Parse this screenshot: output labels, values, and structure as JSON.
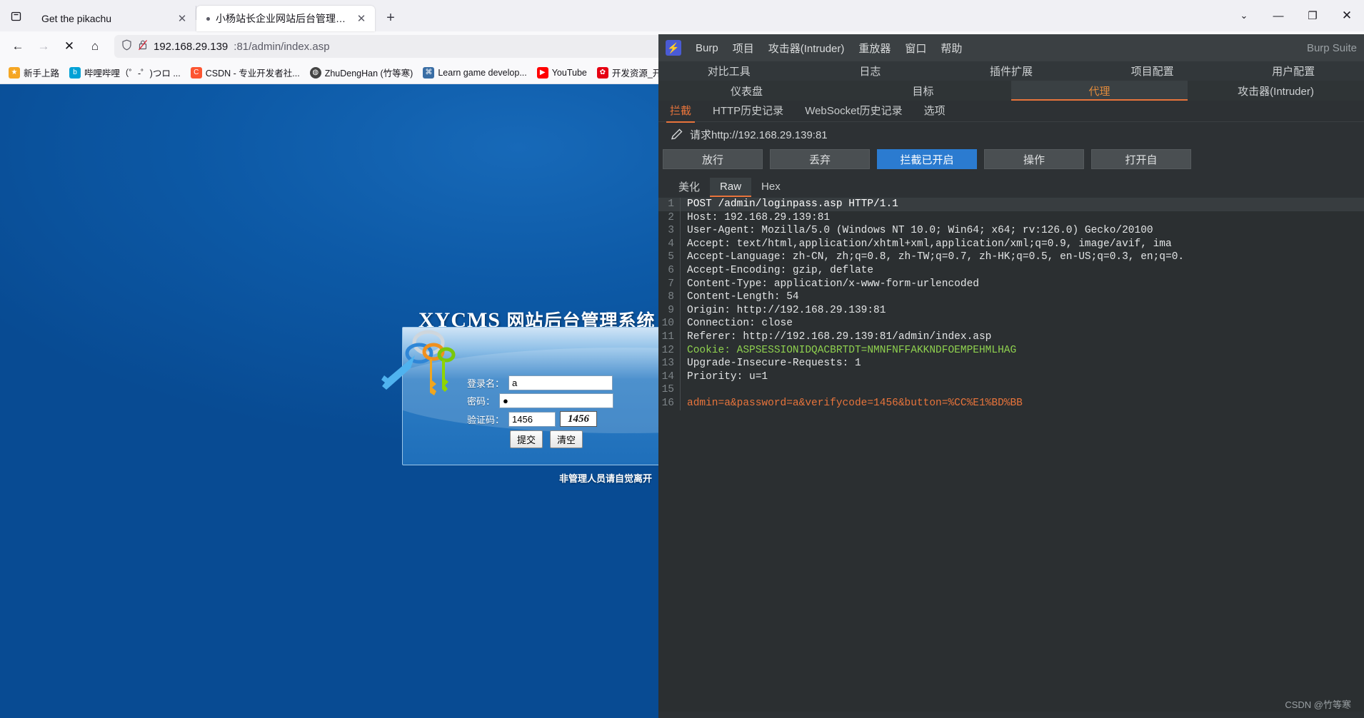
{
  "browser": {
    "tabs": [
      {
        "title": "Get the pikachu",
        "active": false,
        "has_dot": false
      },
      {
        "title": "小杨站长企业网站后台管理系统",
        "active": true,
        "has_dot": true
      }
    ],
    "newtab_label": "+",
    "window_controls": {
      "chevron": "⌄",
      "minimize": "—",
      "maximize": "❐",
      "close": "✕"
    },
    "nav": {
      "back": "←",
      "forward": "→",
      "stop": "✕",
      "home": "⌂"
    },
    "url": {
      "host": "192.168.29.139",
      "rest": ":81/admin/index.asp",
      "shield_icon": "shield-icon",
      "lock_icon": "lock-crossed-icon"
    },
    "bookmarks": [
      {
        "label": "新手上路",
        "color": "#f5a623",
        "glyph": "★"
      },
      {
        "label": "哔哩哔哩（゜-゜)つロ ...",
        "color": "#00a1d6",
        "glyph": "b"
      },
      {
        "label": "CSDN - 专业开发者社...",
        "color": "#fc5531",
        "glyph": "C"
      },
      {
        "label": "ZhuDengHan (竹等寒)",
        "color": "#444444",
        "glyph": "◍"
      },
      {
        "label": "Learn game develop...",
        "color": "#3a6ea5",
        "glyph": "⌘"
      },
      {
        "label": "YouTube",
        "color": "#ff0000",
        "glyph": "▶"
      },
      {
        "label": "开发资源_开发...",
        "color": "#e60012",
        "glyph": "✿"
      }
    ]
  },
  "page": {
    "title_en": "XYCMS",
    "title_cn": "网站后台管理系统",
    "form": {
      "username_label": "登录名：",
      "username_value": "a",
      "password_label": "密码：",
      "password_value": "●",
      "captcha_label": "验证码：",
      "captcha_value": "1456",
      "captcha_image_text": "1456",
      "submit_label": "提交",
      "clear_label": "清空"
    },
    "footnote": "非管理人员请自觉离开"
  },
  "burp": {
    "logo_glyph": "⚡",
    "menu": [
      "Burp",
      "项目",
      "攻击器(Intruder)",
      "重放器",
      "窗口",
      "帮助"
    ],
    "app_name": "Burp Suite",
    "tabs_row1": [
      "对比工具",
      "日志",
      "插件扩展",
      "项目配置",
      "用户配置"
    ],
    "tabs_row2": [
      "仪表盘",
      "目标",
      "代理",
      "攻击器(Intruder)"
    ],
    "tabs_row2_selected": "代理",
    "subtabs": [
      "拦截",
      "HTTP历史记录",
      "WebSocket历史记录",
      "选项"
    ],
    "subtabs_selected": "拦截",
    "request_line": "请求http://192.168.29.139:81",
    "buttons": [
      {
        "label": "放行",
        "primary": false
      },
      {
        "label": "丢弃",
        "primary": false
      },
      {
        "label": "拦截已开启",
        "primary": true
      },
      {
        "label": "操作",
        "primary": false
      },
      {
        "label": "打开自",
        "primary": false
      }
    ],
    "view_tabs": [
      "美化",
      "Raw",
      "Hex"
    ],
    "view_tabs_selected": "Raw",
    "request_lines": [
      {
        "n": 1,
        "text": "POST /admin/loginpass.asp HTTP/1.1",
        "highlight": true
      },
      {
        "n": 2,
        "text": "Host: 192.168.29.139:81"
      },
      {
        "n": 3,
        "text": "User-Agent: Mozilla/5.0 (Windows NT 10.0; Win64; x64; rv:126.0) Gecko/20100"
      },
      {
        "n": 4,
        "text": "Accept: text/html,application/xhtml+xml,application/xml;q=0.9, image/avif, ima"
      },
      {
        "n": 5,
        "text": "Accept-Language: zh-CN, zh;q=0.8, zh-TW;q=0.7, zh-HK;q=0.5, en-US;q=0.3, en;q=0."
      },
      {
        "n": 6,
        "text": "Accept-Encoding: gzip, deflate"
      },
      {
        "n": 7,
        "text": "Content-Type: application/x-www-form-urlencoded"
      },
      {
        "n": 8,
        "text": "Content-Length: 54"
      },
      {
        "n": 9,
        "text": "Origin: http://192.168.29.139:81"
      },
      {
        "n": 10,
        "text": "Connection: close"
      },
      {
        "n": 11,
        "text": "Referer: http://192.168.29.139:81/admin/index.asp"
      },
      {
        "n": 12,
        "text": "Cookie: ASPSESSIONIDQACBRTDT=NMNFNFFAKKNDFOEMPEHMLHAG",
        "cookie": true
      },
      {
        "n": 13,
        "text": "Upgrade-Insecure-Requests: 1"
      },
      {
        "n": 14,
        "text": "Priority: u=1"
      },
      {
        "n": 15,
        "text": ""
      },
      {
        "n": 16,
        "text": "admin=a&password=a&verifycode=1456&button=%CC%E1%BD%BB",
        "body": true
      }
    ],
    "watermark": "CSDN @竹等寒"
  }
}
